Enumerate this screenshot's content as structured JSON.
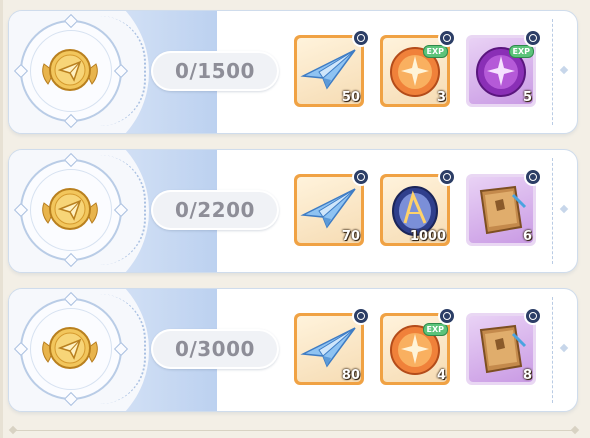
{
  "rows": [
    {
      "progress": "0/1500",
      "rewards": [
        {
          "icon": "paper-plane-icon",
          "count": "50",
          "frame": "gold",
          "exp": false
        },
        {
          "icon": "orange-spirit-orb-icon",
          "count": "3",
          "frame": "gold",
          "exp": true,
          "exp_label": "EXP"
        },
        {
          "icon": "purple-spirit-orb-icon",
          "count": "5",
          "frame": "purple",
          "exp": true,
          "exp_label": "EXP"
        }
      ]
    },
    {
      "progress": "0/2200",
      "rewards": [
        {
          "icon": "paper-plane-icon",
          "count": "70",
          "frame": "gold",
          "exp": false
        },
        {
          "icon": "star-crystal-orb-icon",
          "count": "1000",
          "frame": "gold",
          "exp": false
        },
        {
          "icon": "spell-book-icon",
          "count": "6",
          "frame": "purple",
          "exp": false
        }
      ]
    },
    {
      "progress": "0/3000",
      "rewards": [
        {
          "icon": "paper-plane-icon",
          "count": "80",
          "frame": "gold",
          "exp": false
        },
        {
          "icon": "orange-spirit-orb-icon",
          "count": "4",
          "frame": "gold",
          "exp": true,
          "exp_label": "EXP"
        },
        {
          "icon": "spell-book-icon",
          "count": "8",
          "frame": "purple",
          "exp": false
        }
      ]
    }
  ],
  "colors": {
    "gold_frame": "#f0a244",
    "purple_frame": "#e9d7f3",
    "pin": "#2c3e66",
    "exp_badge": "#5cc37a",
    "progress_text": "#8e8e98"
  }
}
